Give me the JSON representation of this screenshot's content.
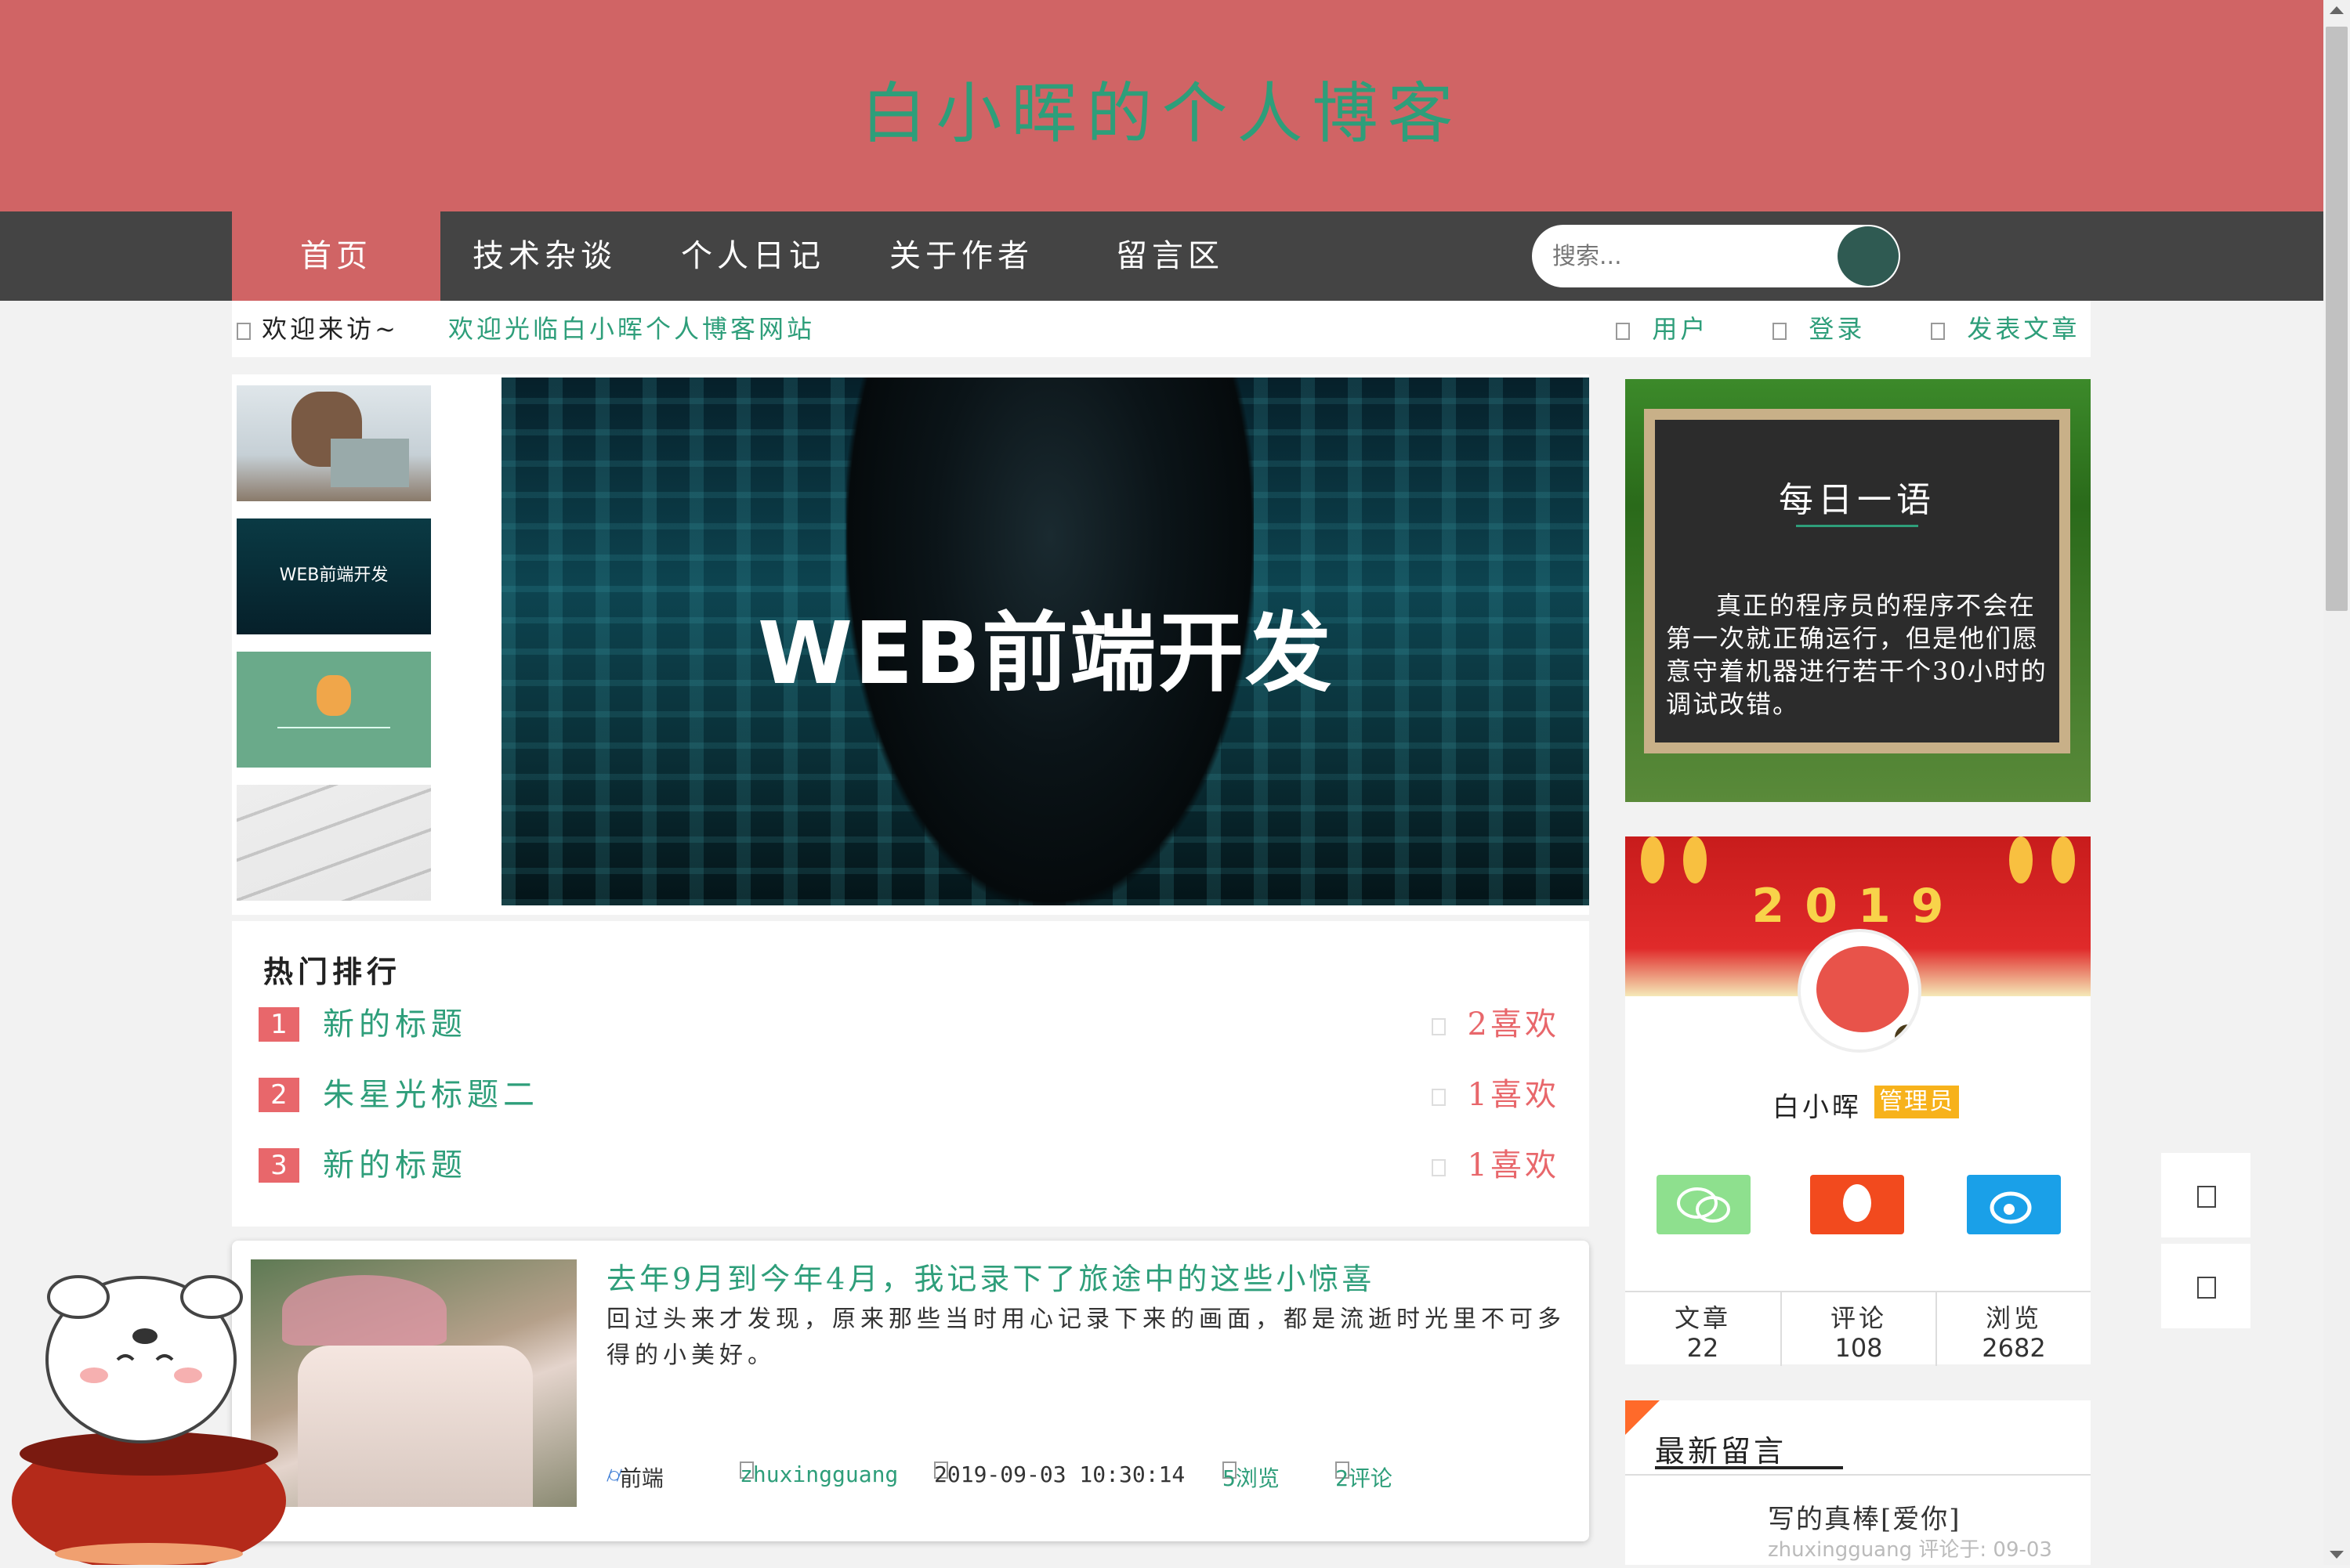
{
  "header": {
    "title": "白小晖的个人博客"
  },
  "nav": {
    "items": [
      "首页",
      "技术杂谈",
      "个人日记",
      "关于作者",
      "留言区"
    ],
    "search_placeholder": "搜索..."
  },
  "subbar": {
    "welcome": "欢迎来访~",
    "marquee": "欢迎光临白小晖个人博客网站",
    "user": "用户",
    "login": "登录",
    "post": "发表文章"
  },
  "banner": {
    "text": "WEB前端开发",
    "thumb2_text": "WEB前端开发"
  },
  "hot": {
    "title": "热门排行",
    "items": [
      {
        "rank": "1",
        "title": "新的标题",
        "likes": "2喜欢"
      },
      {
        "rank": "2",
        "title": "朱星光标题二",
        "likes": "1喜欢"
      },
      {
        "rank": "3",
        "title": "新的标题",
        "likes": "1喜欢"
      }
    ]
  },
  "article": {
    "title": "去年9月到今年4月，我记录下了旅途中的这些小惊喜",
    "desc": "回过头来才发现，原来那些当时用心记录下来的画面，都是流逝时光里不可多得的小美好。",
    "category": "前端",
    "author": "zhuxingguang",
    "date": "2019-09-03 10:30:14",
    "views": "5浏览",
    "comments": "2评论"
  },
  "quote": {
    "title": "每日一语",
    "text": "真正的程序员的程序不会在第一次就正确运行，但是他们愿意守着机器进行若干个30小时的调试改错。"
  },
  "profile": {
    "year": "2019",
    "name": "白小晖",
    "badge": "管理员",
    "stats": [
      {
        "label": "文章",
        "value": "22"
      },
      {
        "label": "评论",
        "value": "108"
      },
      {
        "label": "浏览",
        "value": "2682"
      }
    ]
  },
  "messages": {
    "title": "最新留言",
    "items": [
      {
        "text": "写的真棒[爱你]",
        "author": "zhuxingguang",
        "meta": "评论于: 09-03"
      }
    ]
  },
  "colors": {
    "primary": "#d06465",
    "accent": "#2e9e7a",
    "nav_bg": "#444444",
    "rank": "#e8676b"
  }
}
